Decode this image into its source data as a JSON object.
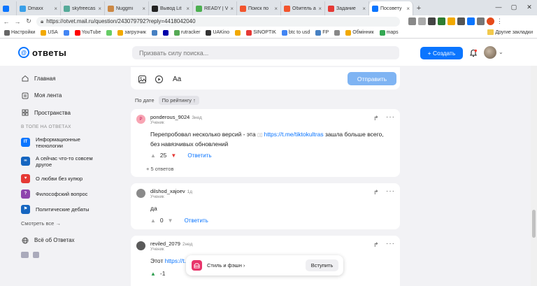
{
  "browser": {
    "tabs": [
      {
        "label": "",
        "color": "#0a75ff",
        "active": false,
        "small": true
      },
      {
        "label": "Dmaxx",
        "color": "#3aa0e8",
        "active": false
      },
      {
        "label": "skyfreecas",
        "color": "#5a9",
        "active": false
      },
      {
        "label": "Nuggmi",
        "color": "#c84",
        "active": false
      },
      {
        "label": "Вывод Lit",
        "color": "#222",
        "active": false
      },
      {
        "label": "READY | V",
        "color": "#4caf50",
        "active": false
      },
      {
        "label": "Поиск по",
        "color": "#f2542d",
        "active": false
      },
      {
        "label": "Обитель а",
        "color": "#f2542d",
        "active": false
      },
      {
        "label": "Задание",
        "color": "#e53935",
        "active": false
      },
      {
        "label": "Посовету",
        "color": "#0a75ff",
        "active": true
      }
    ],
    "url": "https://otvet.mail.ru/question/243079792?reply=4418042040",
    "bookmarks": [
      {
        "label": "Настройки",
        "color": "#666"
      },
      {
        "label": "USA",
        "color": "#f2a900"
      },
      {
        "label": "",
        "color": "#4285f4"
      },
      {
        "label": "YouTube",
        "color": "#ff0000"
      },
      {
        "label": "",
        "color": "#6c6"
      },
      {
        "label": "загрузчик",
        "color": "#f2a900"
      },
      {
        "label": "",
        "color": "#4680c2"
      },
      {
        "label": "",
        "color": "#00a"
      },
      {
        "label": "rutracker",
        "color": "#5a5"
      },
      {
        "label": "UAKino",
        "color": "#333"
      },
      {
        "label": "",
        "color": "#f2a900"
      },
      {
        "label": "SINOPTIK",
        "color": "#e53935"
      },
      {
        "label": "btc to usd",
        "color": "#4285f4"
      },
      {
        "label": "FP",
        "color": "#4680c2"
      },
      {
        "label": "",
        "color": "#888"
      },
      {
        "label": "Обмінник",
        "color": "#f2a900"
      },
      {
        "label": "maps",
        "color": "#34a853"
      }
    ],
    "bookmarks_right": "Другие закладки"
  },
  "header": {
    "logo_text": "ответы",
    "search_placeholder": "Призвать силу поиска...",
    "create_label": "+ Создать"
  },
  "sidebar": {
    "items": [
      {
        "label": "Главная"
      },
      {
        "label": "Моя лента"
      },
      {
        "label": "Пространства"
      }
    ],
    "section_title": "В ТОПЕ НА ОТВЕТАХ",
    "topics": [
      {
        "label1": "Информационные",
        "label2": "технологии",
        "color": "#0a75ff",
        "glyph": "IT"
      },
      {
        "label1": "А сейчас что-то совсем",
        "label2": "другое",
        "color": "#1565c0",
        "glyph": "∞"
      },
      {
        "label1": "О любви без купюр",
        "label2": "",
        "color": "#e53935",
        "glyph": "♥"
      },
      {
        "label1": "Философский вопрос",
        "label2": "",
        "color": "#8e44ad",
        "glyph": "?"
      },
      {
        "label1": "Политические дебаты",
        "label2": "",
        "color": "#1565c0",
        "glyph": "⚑"
      }
    ],
    "see_all": "Смотреть все →",
    "all_about": "Всё об Ответах"
  },
  "composer": {
    "format_label": "Aa",
    "submit_label": "Отправить"
  },
  "sort": {
    "by_date": "По дате",
    "by_rating": "По рейтингу ↑"
  },
  "answers": [
    {
      "author": "ponderous_9024",
      "time": "3нед",
      "role": "Ученик",
      "avatar_color": "#f8a5b3",
      "avatar_letter": "P",
      "text_before": "Перепробовал несколько версий - эта ",
      "link": "https://t.me/tiktokultras",
      "text_after": " зашла больше всего, без навязчивых обновлений",
      "votes": "25",
      "reply": "Ответить",
      "replies_count": "5 ответов"
    },
    {
      "author": "dilshod_xajoev",
      "time": "1д",
      "role": "Ученик",
      "avatar_color": "#8a8a8a",
      "avatar_letter": "",
      "text_before": "да",
      "link": "",
      "text_after": "",
      "votes": "0",
      "reply": "Ответить",
      "replies_count": ""
    },
    {
      "author": "reviled_2079",
      "time": "2нед",
      "role": "Ученик",
      "avatar_color": "#5a5a5a",
      "avatar_letter": "",
      "text_before": "Этот ",
      "link": "https://t.r",
      "text_after": "",
      "votes": "-1",
      "reply": "",
      "replies_count": ""
    }
  ],
  "popup": {
    "text": "Стиль и фэшн ›",
    "button": "Вступить"
  }
}
